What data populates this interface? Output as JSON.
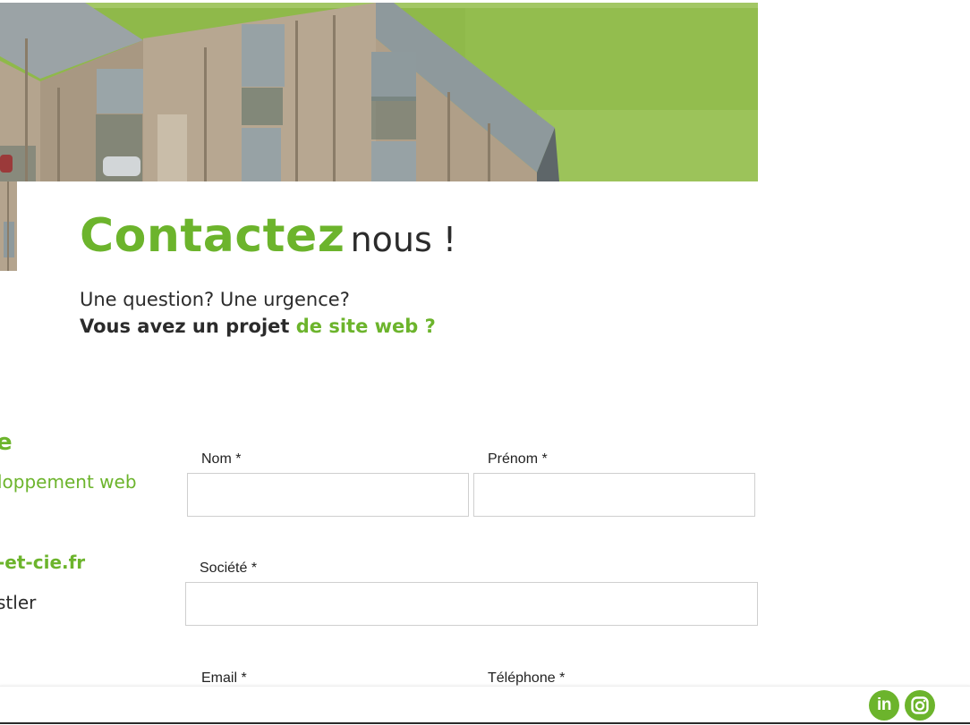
{
  "hero": {
    "image": "aerial-photo-wooden-buildings"
  },
  "heading": {
    "highlight": "Contactez",
    "rest": "nous !"
  },
  "subheading": {
    "line1": "Une question? Une urgence?",
    "line2_main": "Vous avez un projet",
    "line2_highlight": "de site web ?"
  },
  "sidebar": {
    "title_fragment": "e",
    "tagline_fragment": "loppement web",
    "website_fragment": "-et-cie.fr",
    "name_fragment": "stler"
  },
  "form": {
    "nom_label": "Nom *",
    "prenom_label": "Prénom *",
    "societe_label": "Société *",
    "email_label": "Email *",
    "telephone_label": "Téléphone *"
  },
  "social": {
    "linkedin_label": "in",
    "linkedin_icon": "linkedin-icon",
    "instagram_icon": "instagram-icon"
  },
  "colors": {
    "accent": "#6cb42c",
    "text": "#2b2b2b"
  }
}
